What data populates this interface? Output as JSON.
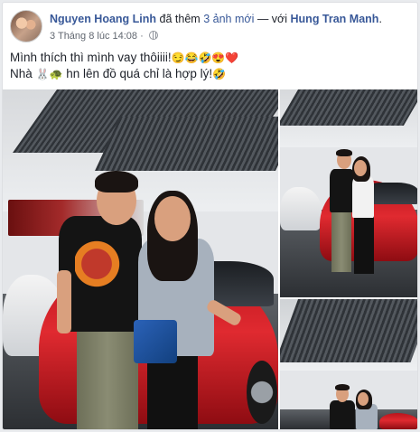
{
  "post": {
    "author": "Nguyen Hoang Linh",
    "action_prefix": "đã thêm",
    "photo_count_text": "3 ảnh mới",
    "with_text": "— với",
    "tagged_person": "Hung Tran Manh",
    "tagged_suffix": ".",
    "timestamp": "3 Tháng 8 lúc 14:08",
    "timestamp_sep": "·",
    "status_line1": "Mình thích thì mình vay thôiiii!",
    "status_line1_emojis": "😏😂🤣😍❤️",
    "status_line2_prefix": "Nhà",
    "status_line2_emojis": "🐰🐢",
    "status_line2_text": "hn lên đồ quá chỉ là hợp lý!",
    "status_line2_end_emoji": "🤣"
  },
  "photos": [
    {
      "label": "photo-1"
    },
    {
      "label": "photo-2"
    },
    {
      "label": "photo-3"
    }
  ],
  "colors": {
    "link": "#385898",
    "text": "#1d2129",
    "muted": "#616770",
    "car_red": "#d0202a"
  },
  "icons": {
    "privacy": "globe-icon"
  }
}
